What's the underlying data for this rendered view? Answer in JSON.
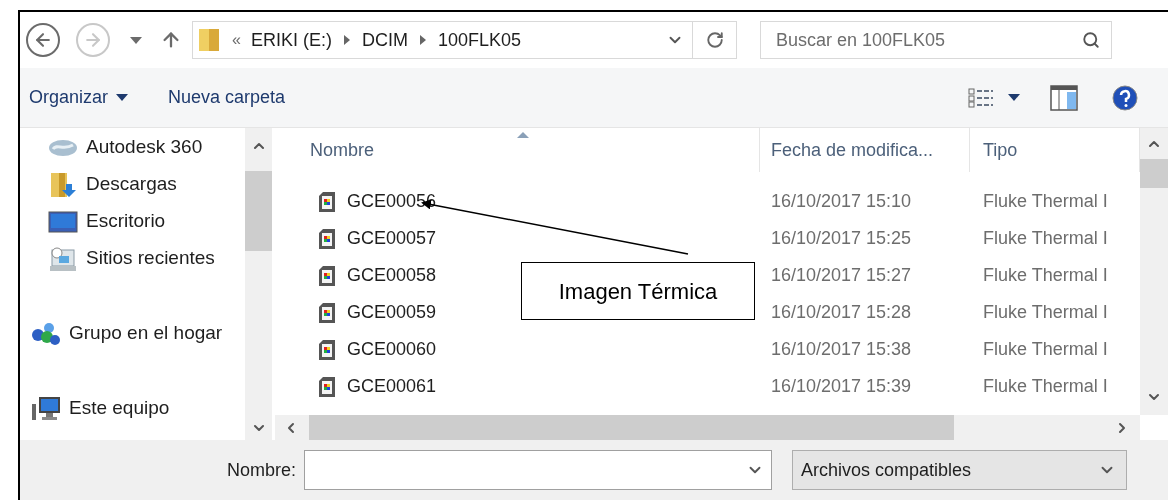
{
  "nav": {
    "buttons": [
      {
        "kind": "back",
        "disabled": false
      },
      {
        "kind": "forward",
        "disabled": true
      },
      {
        "kind": "recent",
        "disabled": false
      },
      {
        "kind": "up",
        "disabled": false
      }
    ]
  },
  "breadcrumb": {
    "overflow": "«",
    "parts": [
      "ERIKI (E:)",
      "DCIM",
      "100FLK05"
    ]
  },
  "search": {
    "placeholder": "Buscar en 100FLK05"
  },
  "commands": [
    {
      "label": "Organizar",
      "dropdown": true
    },
    {
      "label": "Nueva carpeta",
      "dropdown": false
    }
  ],
  "sidebar": {
    "sections": [
      {
        "children": [
          {
            "label": "Autodesk 360",
            "kind": "cloud"
          },
          {
            "label": "Descargas",
            "kind": "downloads"
          },
          {
            "label": "Escritorio",
            "kind": "desktop"
          },
          {
            "label": "Sitios recientes",
            "kind": "recent"
          }
        ]
      },
      {
        "label": "Grupo en el hogar",
        "kind": "homegroup"
      },
      {
        "label": "Este equipo",
        "kind": "computer"
      }
    ]
  },
  "table": {
    "columns": [
      {
        "label": "Nombre",
        "sorted": true
      },
      {
        "label": "Fecha de modifica...",
        "sorted": false
      },
      {
        "label": "Tipo",
        "sorted": false
      }
    ],
    "rows": [
      {
        "name": "GCE00056",
        "date": "16/10/2017 15:10",
        "type": "Fluke Thermal I"
      },
      {
        "name": "GCE00057",
        "date": "16/10/2017 15:25",
        "type": "Fluke Thermal I"
      },
      {
        "name": "GCE00058",
        "date": "16/10/2017 15:27",
        "type": "Fluke Thermal I"
      },
      {
        "name": "GCE00059",
        "date": "16/10/2017 15:28",
        "type": "Fluke Thermal I"
      },
      {
        "name": "GCE00060",
        "date": "16/10/2017 15:38",
        "type": "Fluke Thermal I"
      },
      {
        "name": "GCE00061",
        "date": "16/10/2017 15:39",
        "type": "Fluke Thermal I"
      }
    ]
  },
  "annotation": {
    "text": "Imagen Térmica"
  },
  "footer": {
    "filename_label": "Nombre:",
    "filter": "Archivos compatibles"
  }
}
